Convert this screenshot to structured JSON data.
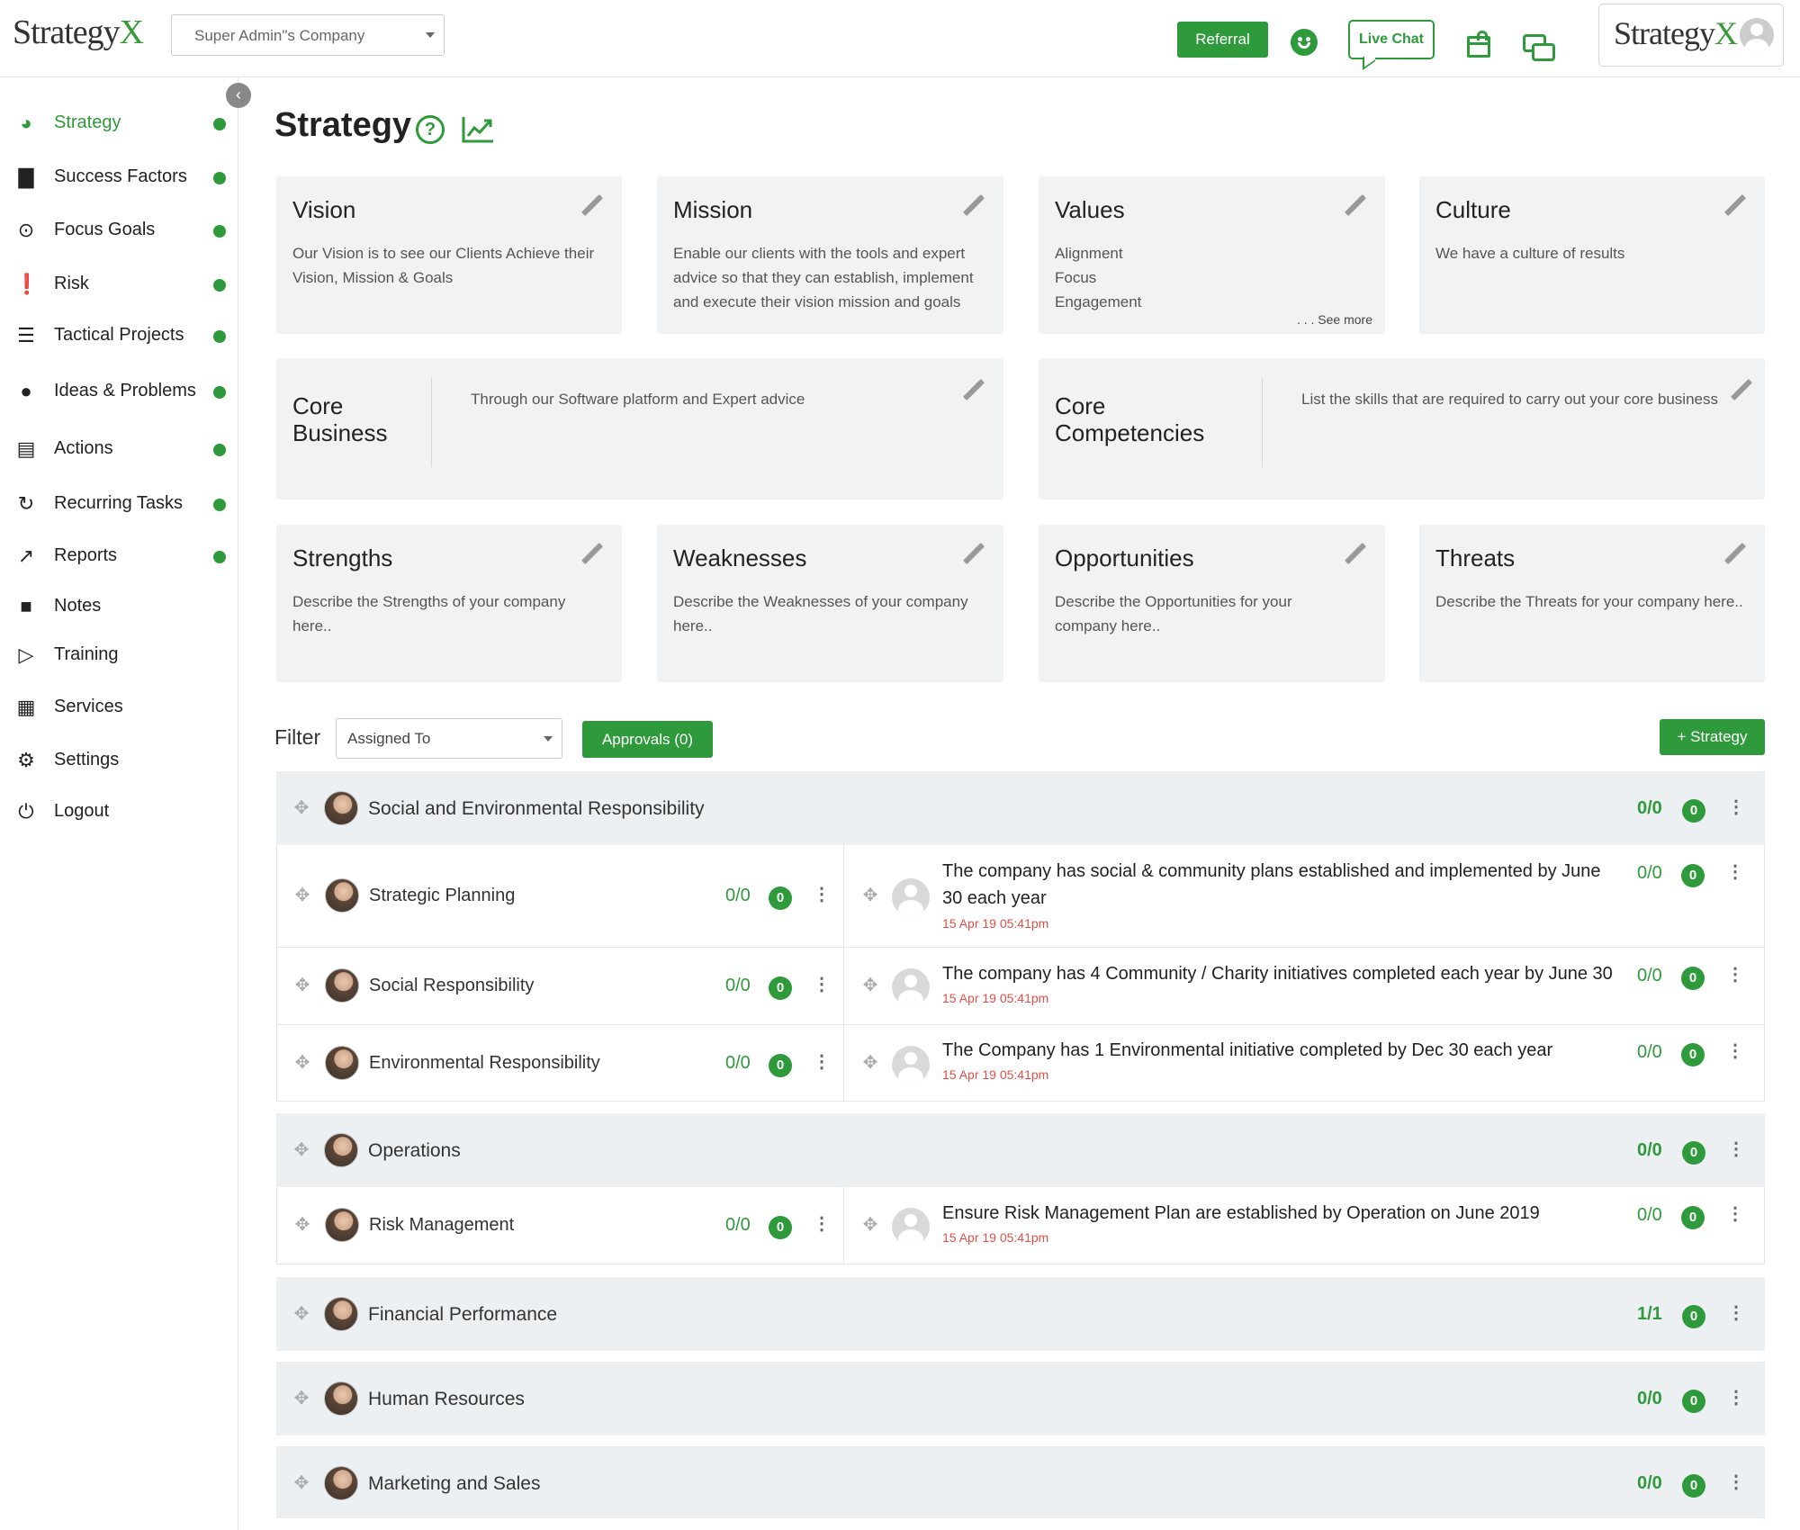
{
  "header": {
    "logo_text": "Strategy",
    "logo_accent": "X",
    "company_select": "Super Admin\"s Company",
    "referral_label": "Referral",
    "livechat_label": "Live Chat",
    "user_logo_text": "Strategy",
    "user_logo_accent": "X"
  },
  "sidebar": {
    "items": [
      {
        "label": "Strategy",
        "icon": "pie-chart-icon",
        "active": true,
        "dot": true
      },
      {
        "label": "Success Factors",
        "icon": "bar-chart-icon",
        "dot": true
      },
      {
        "label": "Focus Goals",
        "icon": "focus-icon",
        "dot": true
      },
      {
        "label": "Risk",
        "icon": "alert-icon",
        "dot": true
      },
      {
        "label": "Tactical Projects",
        "icon": "tasks-icon",
        "dot": true
      },
      {
        "label": "Ideas & Problems",
        "icon": "lightbulb-icon",
        "dot": true
      },
      {
        "label": "Actions",
        "icon": "checklist-icon",
        "dot": true
      },
      {
        "label": "Recurring Tasks",
        "icon": "refresh-icon",
        "dot": true
      },
      {
        "label": "Reports",
        "icon": "line-chart-icon",
        "dot": true
      },
      {
        "label": "Notes",
        "icon": "folder-icon",
        "dot": false
      },
      {
        "label": "Training",
        "icon": "video-icon",
        "dot": false
      },
      {
        "label": "Services",
        "icon": "grid-icon",
        "dot": false
      },
      {
        "label": "Settings",
        "icon": "gear-icon",
        "dot": false
      },
      {
        "label": "Logout",
        "icon": "power-icon",
        "dot": false
      }
    ]
  },
  "page": {
    "title": "Strategy",
    "help_glyph": "?"
  },
  "cards": {
    "vision": {
      "title": "Vision",
      "text": "Our Vision is to see our Clients Achieve their Vision, Mission & Goals"
    },
    "mission": {
      "title": "Mission",
      "text": "Enable our clients with the tools and expert advice  so that they can establish, implement and execute their vision mission and goals"
    },
    "values": {
      "title": "Values",
      "lines": [
        "Alignment",
        "Focus",
        "Engagement"
      ],
      "see_more": ". . . See more"
    },
    "culture": {
      "title": "Culture",
      "text": "We have a culture of results"
    },
    "core_business": {
      "title_line1": "Core",
      "title_line2": "Business",
      "text": "Through our Software platform and Expert advice"
    },
    "core_competencies": {
      "title_line1": "Core",
      "title_line2": "Competencies",
      "text": "List the skills that are required to carry out your core business"
    },
    "strengths": {
      "title": "Strengths",
      "text": "Describe the Strengths of your company here.."
    },
    "weaknesses": {
      "title": "Weaknesses",
      "text": "Describe the Weaknesses of your company here.."
    },
    "opportunities": {
      "title": "Opportunities",
      "text": "Describe the Opportunities for your company here.."
    },
    "threats": {
      "title": "Threats",
      "text": "Describe the Threats for your company here.."
    }
  },
  "filter": {
    "label": "Filter",
    "select_value": "Assigned To",
    "approvals_label": "Approvals  (0)",
    "add_label": "+ Strategy"
  },
  "groups": [
    {
      "title": "Social and Environmental Responsibility",
      "score": "0/0",
      "badge": "0",
      "items": [
        {
          "title": "Strategic Planning",
          "score": "0/0",
          "badge": "0",
          "goal": "The company has social & community plans established and implemented by June 30 each year",
          "date": "15 Apr 19 05:41pm",
          "goal_score": "0/0",
          "goal_badge": "0"
        },
        {
          "title": "Social Responsibility",
          "score": "0/0",
          "badge": "0",
          "goal": "The company has 4 Community / Charity initiatives completed each year by June 30",
          "date": "15 Apr 19 05:41pm",
          "goal_score": "0/0",
          "goal_badge": "0"
        },
        {
          "title": "Environmental Responsibility",
          "score": "0/0",
          "badge": "0",
          "goal": "The Company has 1 Environmental initiative completed by Dec 30 each year",
          "date": "15 Apr 19 05:41pm",
          "goal_score": "0/0",
          "goal_badge": "0"
        }
      ]
    },
    {
      "title": "Operations",
      "score": "0/0",
      "badge": "0",
      "items": [
        {
          "title": "Risk Management",
          "score": "0/0",
          "badge": "0",
          "goal": "Ensure Risk Management Plan are established by Operation on June 2019",
          "date": "15 Apr 19 05:41pm",
          "goal_score": "0/0",
          "goal_badge": "0"
        }
      ]
    },
    {
      "title": "Financial Performance",
      "score": "1/1",
      "badge": "0",
      "items": []
    },
    {
      "title": "Human Resources",
      "score": "0/0",
      "badge": "0",
      "items": []
    },
    {
      "title": "Marketing and Sales",
      "score": "0/0",
      "badge": "0",
      "items": []
    }
  ],
  "colors": {
    "accent": "#2e9a3c",
    "date": "#e0504a",
    "card_bg": "#f0f2f4"
  }
}
